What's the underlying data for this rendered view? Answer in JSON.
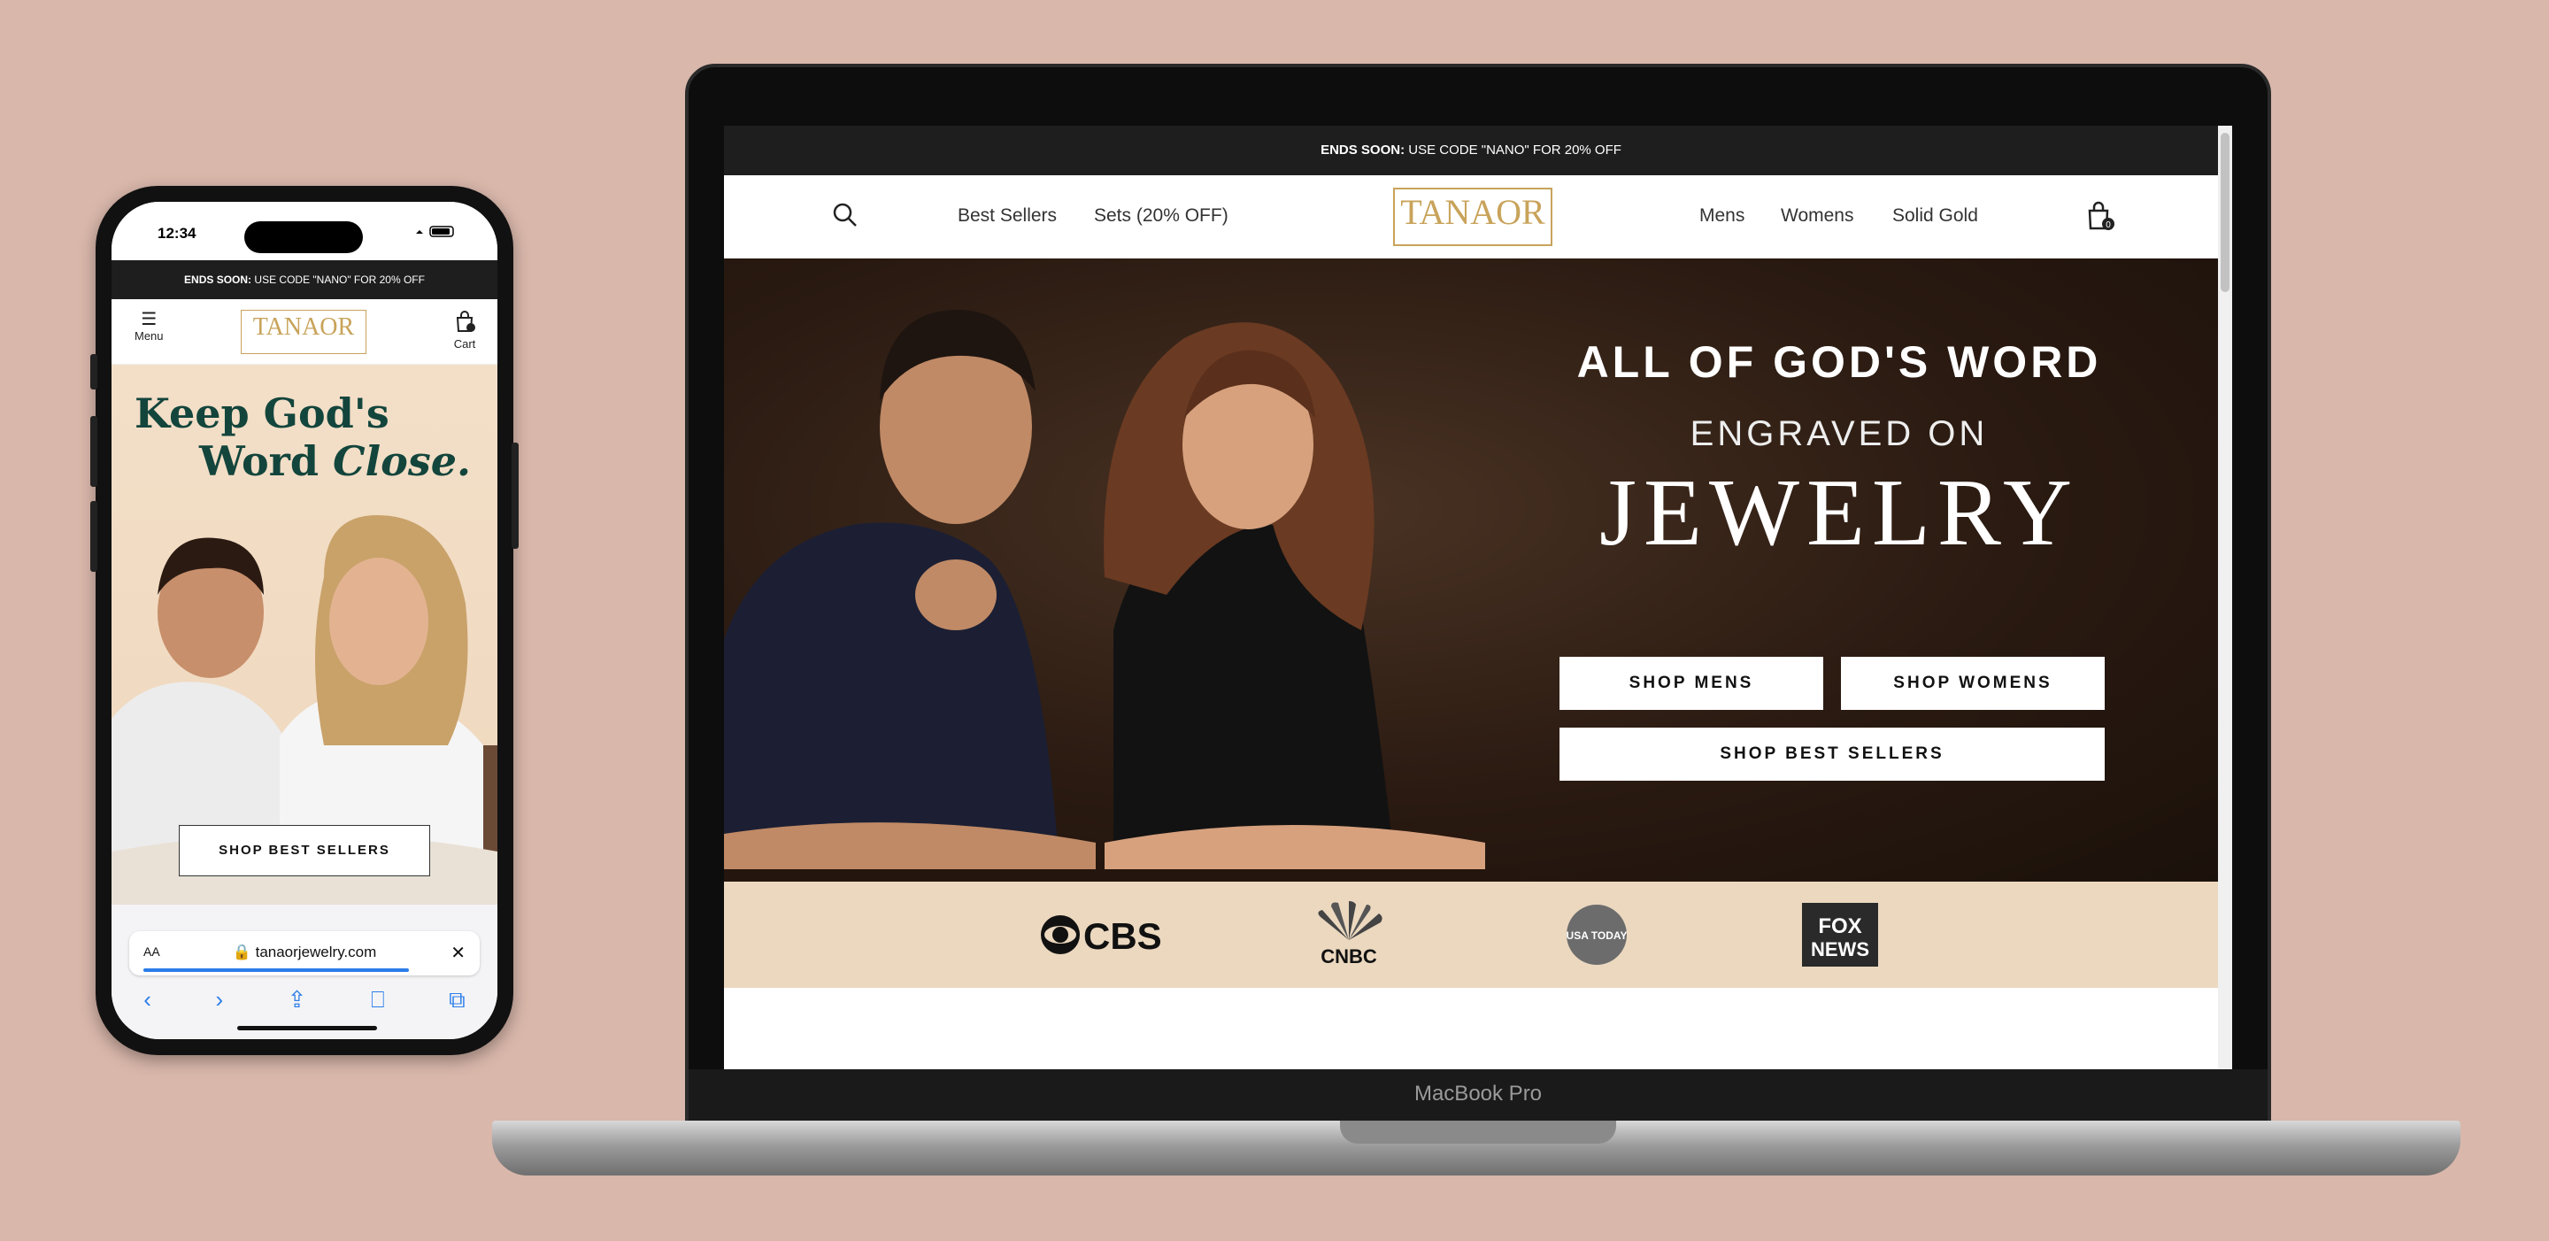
{
  "promo": {
    "lead": "ENDS SOON:",
    "text": " USE CODE \"NANO\" FOR 20% OFF"
  },
  "mobile": {
    "time": "12:34",
    "menu_label": "Menu",
    "cart_label": "Cart",
    "logo": "TANAOR",
    "hero_line1": "Keep God's",
    "hero_line2a": "Word ",
    "hero_line2b": "Close.",
    "shop_button": "SHOP BEST SELLERS",
    "url_aa": "AA",
    "url": "🔒 tanaorjewelry.com",
    "close": "✕",
    "nav": [
      "‹",
      "›",
      "⇪",
      "⎕",
      "⧉"
    ]
  },
  "desktop": {
    "nav_left": [
      "Best Sellers",
      "Sets (20% OFF)"
    ],
    "logo": "TANAOR",
    "nav_right": [
      "Mens",
      "Womens",
      "Solid Gold"
    ],
    "cart_count": "0",
    "hero_line1": "ALL OF GOD'S WORD",
    "hero_line2": "ENGRAVED ON",
    "hero_line3": "JEWELRY",
    "btn_mens": "SHOP MENS",
    "btn_womens": "SHOP WOMENS",
    "btn_best": "SHOP BEST SELLERS",
    "press": [
      "CBS",
      "CNBC",
      "USA TODAY",
      "FOX NEWS"
    ]
  },
  "device_label": "MacBook Pro",
  "colors": {
    "background": "#d9b7ab",
    "banner": "#1e1e1e",
    "gold": "#c8a35a",
    "hero_green": "#13453c",
    "press_bg": "#ebd8bf"
  }
}
